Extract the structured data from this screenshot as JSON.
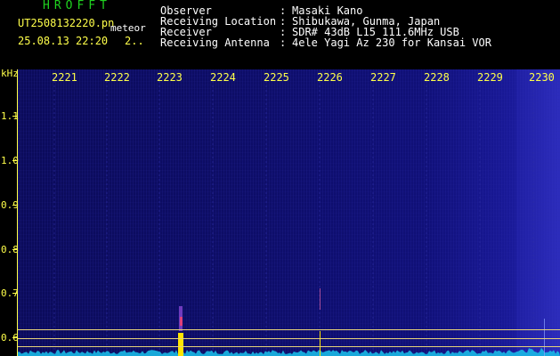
{
  "app": {
    "title": "HROFFT"
  },
  "file": {
    "name": "UT2508132220.pn",
    "mode": "meteor",
    "timestamp": "25.08.13 22:20",
    "extra": "2.."
  },
  "meta": {
    "observer_label": "Observer",
    "observer_value": "Masaki Kano",
    "location_label": "Receiving Location",
    "location_value": "Shibukawa, Gunma, Japan",
    "receiver_label": "Receiver",
    "receiver_value": "SDR# 43dB L15 111.6MHz USB",
    "antenna_label": "Receiving Antenna",
    "antenna_value": "4ele Yagi Az 230 for Kansai VOR",
    "colon": ":"
  },
  "axis": {
    "unit": "kHz",
    "y_ticks": [
      "1.1",
      "1.0",
      "0.9",
      "0.8",
      "0.7",
      "0.6"
    ],
    "x_ticks": [
      "2221",
      "2222",
      "2223",
      "2224",
      "2225",
      "2226",
      "2227",
      "2228",
      "2229",
      "2230"
    ]
  },
  "colors": {
    "text_yellow": "#ffff4a",
    "title_green": "#1fd21f",
    "background": "#0d0d66",
    "noise_cyan": "#19b9e6",
    "echo_yellow": "#ffe400"
  }
}
